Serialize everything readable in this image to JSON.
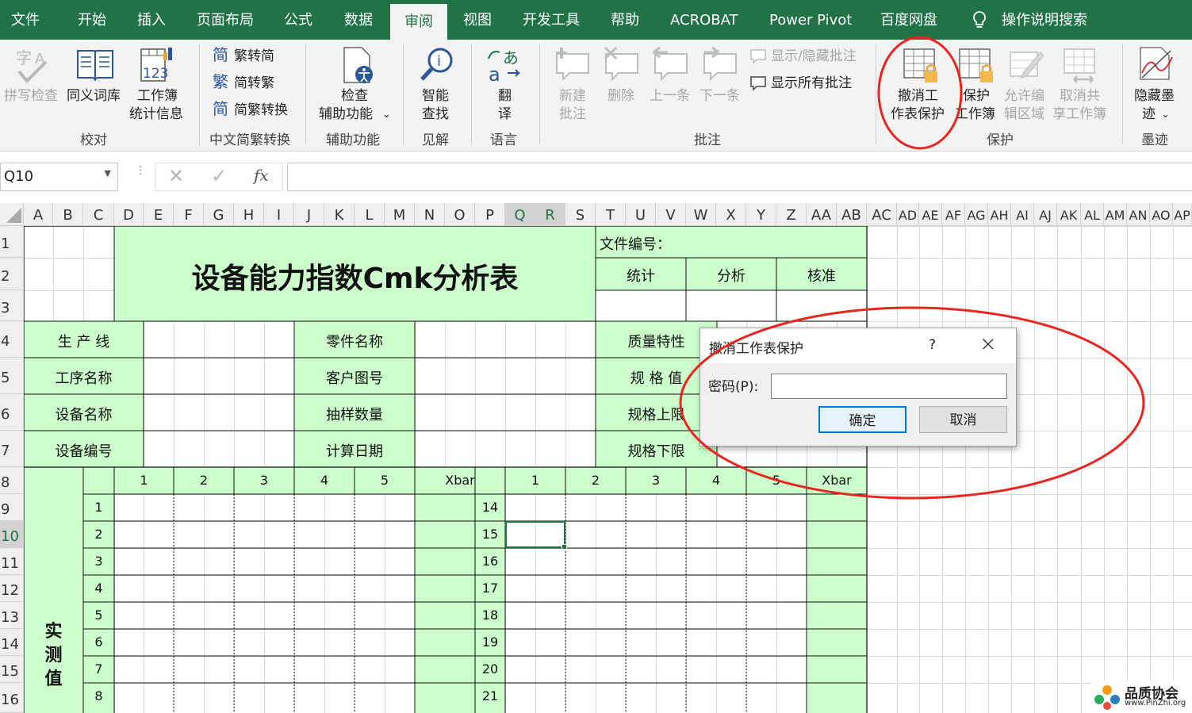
{
  "tabs": [
    "文件",
    "开始",
    "插入",
    "页面布局",
    "公式",
    "数据",
    "审阅",
    "视图",
    "开发工具",
    "帮助",
    "ACROBAT",
    "Power Pivot",
    "百度网盘",
    "操作说明搜索"
  ],
  "active_tab": "审阅",
  "ribbon": {
    "proofing": {
      "spell": "拼写检查",
      "thesaurus": "同义词库",
      "stats": [
        "工作簿",
        "统计信息"
      ],
      "stats_num": "123",
      "group": "校对"
    },
    "chinese": {
      "t2s": "繁转简",
      "s2t": "简转繁",
      "conv": "简繁转换",
      "group": "中文简繁转换",
      "g1": "简",
      "g2": "繁",
      "g3": "简"
    },
    "access": {
      "label": [
        "检查",
        "辅助功能"
      ],
      "group": "辅助功能"
    },
    "insights": {
      "label": [
        "智能",
        "查找"
      ],
      "group": "见解"
    },
    "language": {
      "label": [
        "翻",
        "译"
      ],
      "group": "语言"
    },
    "comments": {
      "new": [
        "新建",
        "批注"
      ],
      "delete": "删除",
      "prev": "上一条",
      "next": "下一条",
      "toggle": "显示/隐藏批注",
      "showall": "显示所有批注",
      "group": "批注"
    },
    "protect": {
      "unprotect": [
        "撤消工",
        "作表保护"
      ],
      "protect_wb": [
        "保护",
        "工作簿"
      ],
      "allow_edit": [
        "允许编",
        "辑区域"
      ],
      "unshare": [
        "取消共",
        "享工作簿"
      ],
      "group": "保护"
    },
    "ink": {
      "hide": [
        "隐藏墨",
        "迹"
      ],
      "group": "墨迹"
    }
  },
  "formula_bar": {
    "name_box": "Q10",
    "fx": "fx",
    "formula": ""
  },
  "columns": [
    "A",
    "B",
    "C",
    "D",
    "E",
    "F",
    "G",
    "H",
    "I",
    "J",
    "K",
    "L",
    "M",
    "N",
    "O",
    "P",
    "Q",
    "R",
    "S",
    "T",
    "U",
    "V",
    "W",
    "X",
    "Y",
    "Z",
    "AA",
    "AB",
    "AC",
    "AD",
    "AE",
    "AF",
    "AG",
    "AH",
    "AI",
    "AJ",
    "AK",
    "AL",
    "AM",
    "AN",
    "AO",
    "AP"
  ],
  "selected_columns": [
    "Q",
    "R"
  ],
  "rows": [
    "1",
    "2",
    "3",
    "4",
    "5",
    "6",
    "7",
    "8",
    "9",
    "10",
    "11",
    "12",
    "13",
    "14",
    "15",
    "16"
  ],
  "selected_row": "10",
  "sheet": {
    "title": "设备能力指数Cmk分析表",
    "file_no": "文件编号：",
    "stat": "统计",
    "analyze": "分析",
    "approve": "核准",
    "line": "生 产 线",
    "process": "工序名称",
    "equip_name": "设备名称",
    "equip_no": "设备编号",
    "part": "零件名称",
    "drawing": "客户图号",
    "sample": "抽样数量",
    "calc_date": "计算日期",
    "quality": "质量特性",
    "spec": "规 格 值",
    "usl": "规格上限",
    "lsl": "规格下限",
    "measured": [
      "实",
      "测",
      "值"
    ],
    "headers_left": [
      "1",
      "2",
      "3",
      "4",
      "5",
      "Xbar"
    ],
    "headers_right": [
      "1",
      "2",
      "3",
      "4",
      "5",
      "Xbar"
    ],
    "idx_left": [
      "1",
      "2",
      "3",
      "4",
      "5",
      "6",
      "7",
      "8"
    ],
    "idx_right": [
      "14",
      "15",
      "16",
      "17",
      "18",
      "19",
      "20",
      "21"
    ]
  },
  "dialog": {
    "title": "撤消工作表保护",
    "help": "?",
    "close": "×",
    "label": "密码(P):",
    "password": "",
    "ok": "确定",
    "cancel": "取消"
  },
  "watermark": {
    "name": "品质协会",
    "url": "www.PinZhi.org"
  },
  "colors": {
    "excel_green": "#217346",
    "cell_green": "#ccffcc",
    "annot_red": "#e8251e"
  }
}
